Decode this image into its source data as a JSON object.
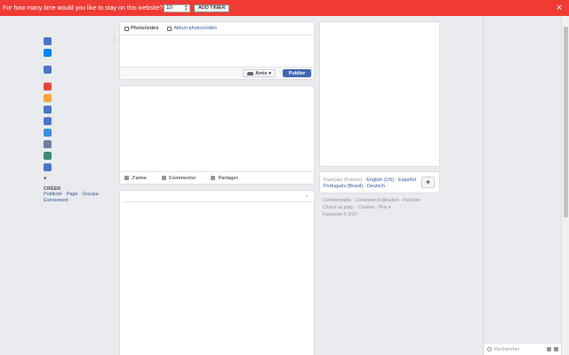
{
  "timer_bar": {
    "question": "For how many time would you like to stay on this website?",
    "select_value": "10",
    "add_button": "ADD TIMER",
    "close_symbol": "×",
    "background_color": "#f03b35"
  },
  "left_nav": {
    "icons": [
      {
        "name": "news-feed-icon",
        "color": "#4a76c7"
      },
      {
        "name": "messenger-icon",
        "color": "#0084ff"
      },
      {
        "name": "groups-icon",
        "color": "#4a76c7"
      },
      {
        "name": "events-icon",
        "color": "#e04a3c"
      },
      {
        "name": "pages-icon",
        "color": "#f3a53a"
      },
      {
        "name": "friends-icon",
        "color": "#4a76c7"
      },
      {
        "name": "lists-icon",
        "color": "#4a76c7"
      },
      {
        "name": "games-icon",
        "color": "#3b8fd8"
      },
      {
        "name": "search-people-icon",
        "color": "#6b7e9c"
      },
      {
        "name": "photos-icon",
        "color": "#3d8b6b"
      },
      {
        "name": "memories-icon",
        "color": "#4a76c7"
      },
      {
        "name": "see-more-icon",
        "color": "#606770"
      }
    ],
    "create_title": "CRÉER",
    "create_links": [
      "Publicité",
      "Page",
      "Groupe",
      "Évènement"
    ]
  },
  "composer": {
    "tab_photo": "Photo/vidéo",
    "tab_album": "Album photos/vidéo",
    "audience_label": "Amis",
    "publish_label": "Publier"
  },
  "post": {
    "like_label": "J'aime",
    "comment_label": "Commenter",
    "share_label": "Partager"
  },
  "languages": {
    "current": "Français (France)",
    "others": [
      "English (US)",
      "Español",
      "Português (Brasil)",
      "Deutsch"
    ],
    "plus_symbol": "+"
  },
  "footer": {
    "links": [
      "Confidentialité",
      "Conditions d'utilisation",
      "Publicité",
      "Choisir sa pub",
      "Cookies",
      "Plus"
    ],
    "copyright": "Facebook © 2017"
  },
  "chat": {
    "search_placeholder": "Rechercher"
  }
}
